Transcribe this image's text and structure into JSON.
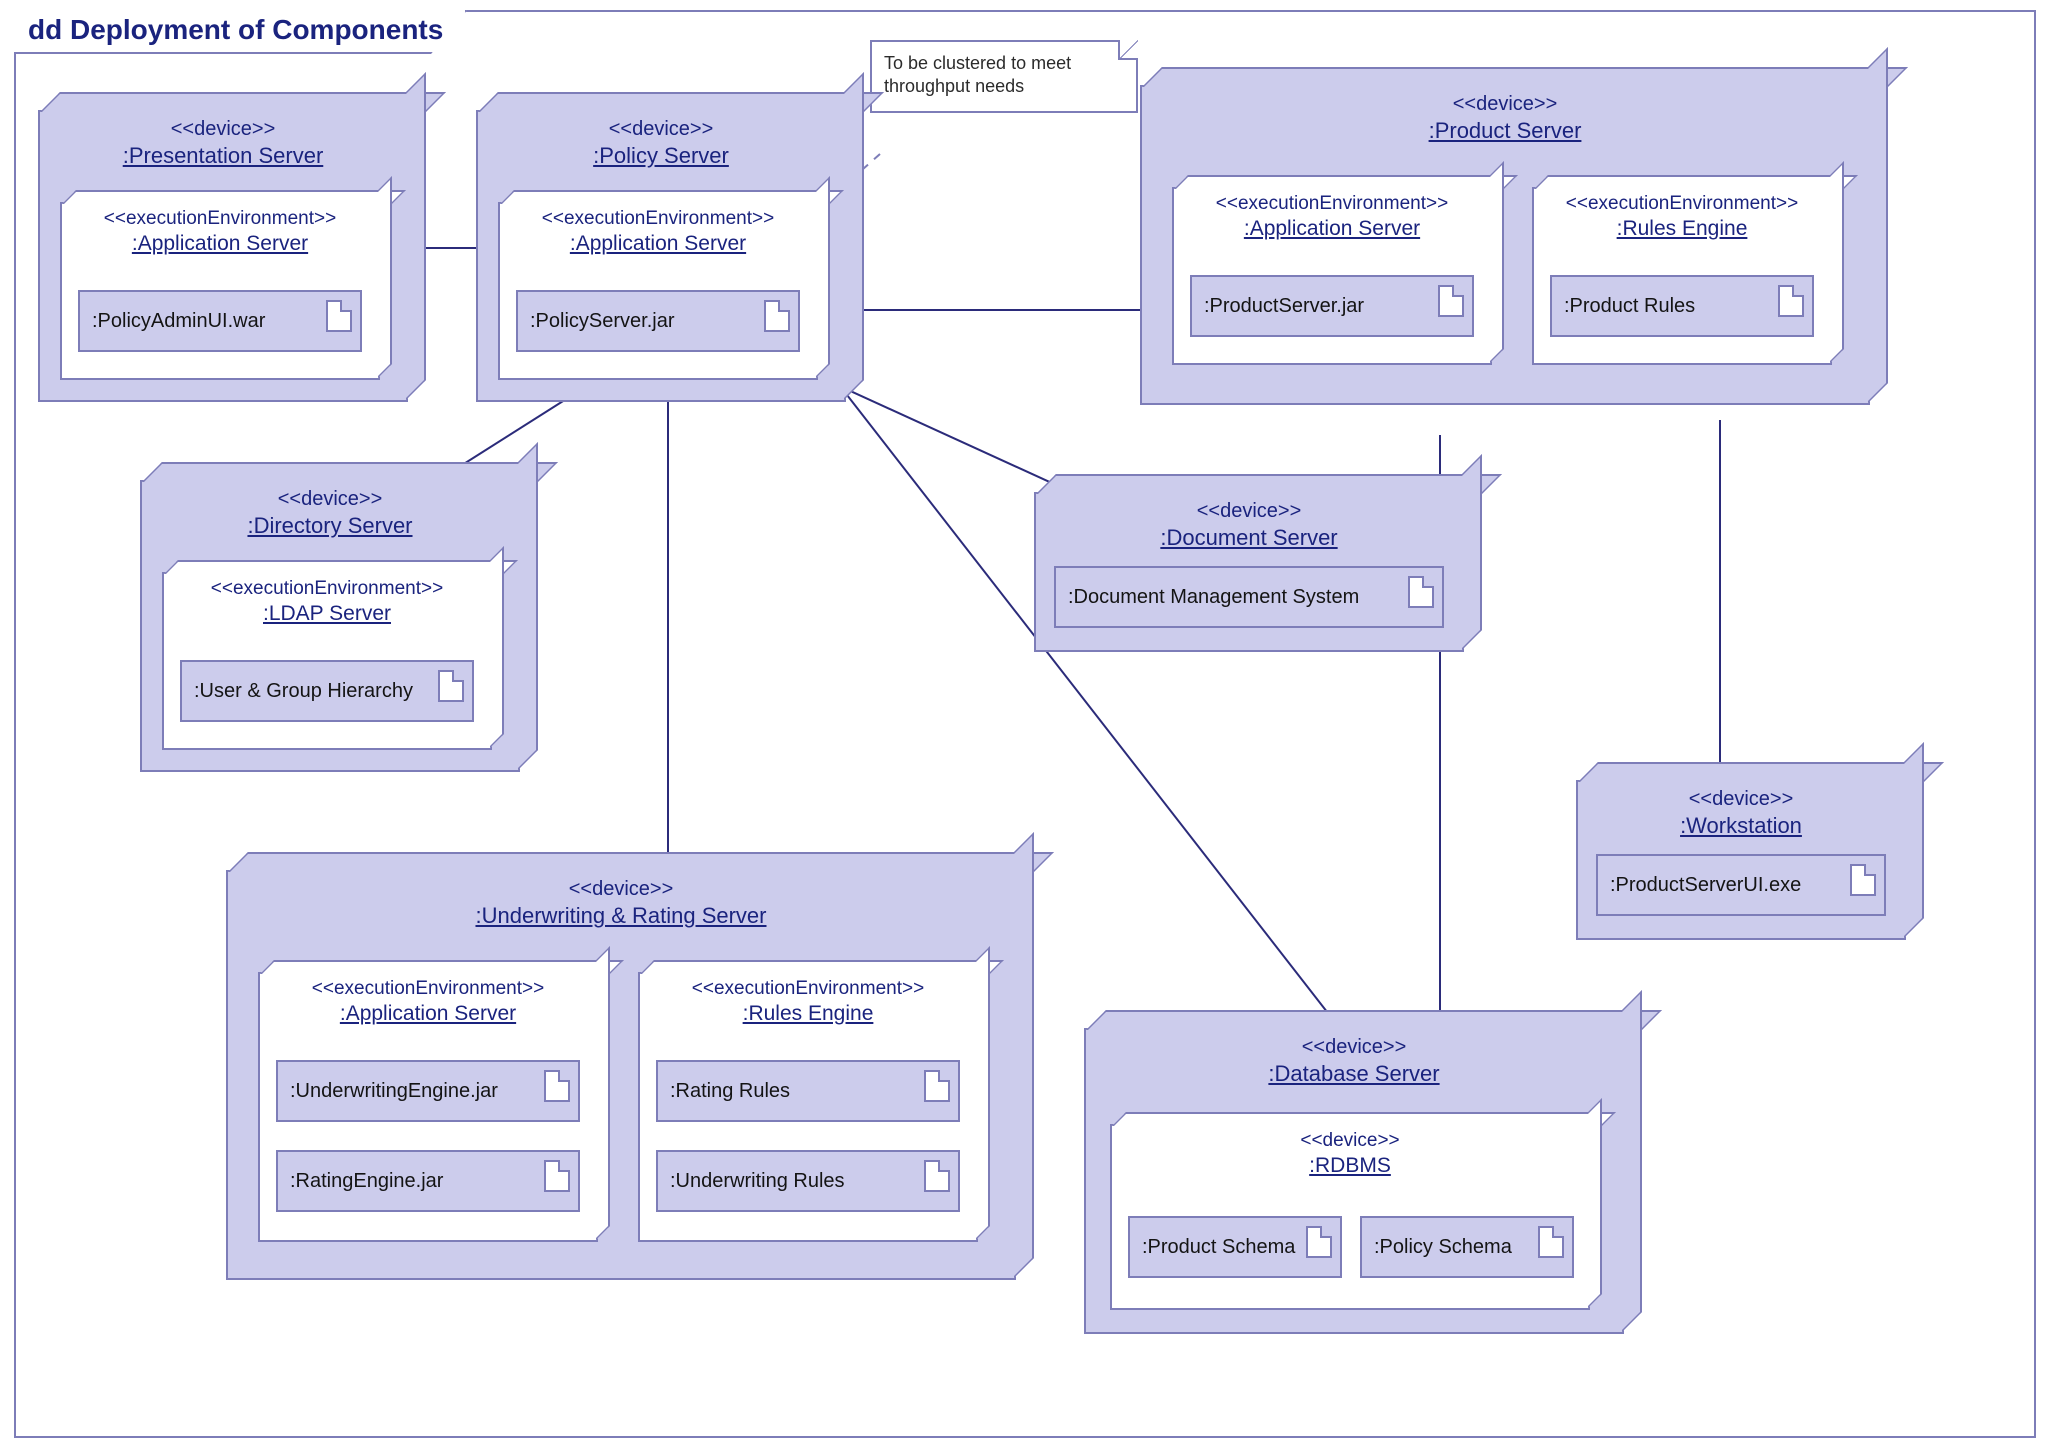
{
  "diagram": {
    "frame_title": "dd Deployment of Components",
    "note": "To be clustered to meet throughput needs"
  },
  "stereotypes": {
    "device": "<<device>>",
    "exec_env": "<<executionEnvironment>>"
  },
  "nodes": {
    "presentation": {
      "title": ":Presentation Server",
      "env1": {
        "title": ":Application Server",
        "art1": ":PolicyAdminUI.war"
      }
    },
    "policy": {
      "title": ":Policy Server",
      "env1": {
        "title": ":Application Server",
        "art1": ":PolicyServer.jar"
      }
    },
    "product": {
      "title": ":Product Server",
      "env1": {
        "title": ":Application Server",
        "art1": ":ProductServer.jar"
      },
      "env2": {
        "title": ":Rules Engine",
        "art1": ":Product Rules"
      }
    },
    "directory": {
      "title": ":Directory Server",
      "env1": {
        "title": ":LDAP Server",
        "art1": ":User & Group Hierarchy"
      }
    },
    "document": {
      "title": ":Document Server",
      "art1": ":Document Management System"
    },
    "underwriting": {
      "title": ":Underwriting & Rating Server",
      "env1": {
        "title": ":Application Server",
        "art1": ":UnderwritingEngine.jar",
        "art2": ":RatingEngine.jar"
      },
      "env2": {
        "title": ":Rules Engine",
        "art1": ":Rating Rules",
        "art2": ":Underwriting Rules"
      }
    },
    "workstation": {
      "title": ":Workstation",
      "art1": ":ProductServerUI.exe"
    },
    "database": {
      "title": ":Database Server",
      "env1": {
        "title": ":RDBMS",
        "art1": ":Product Schema",
        "art2": ":Policy Schema"
      }
    }
  }
}
